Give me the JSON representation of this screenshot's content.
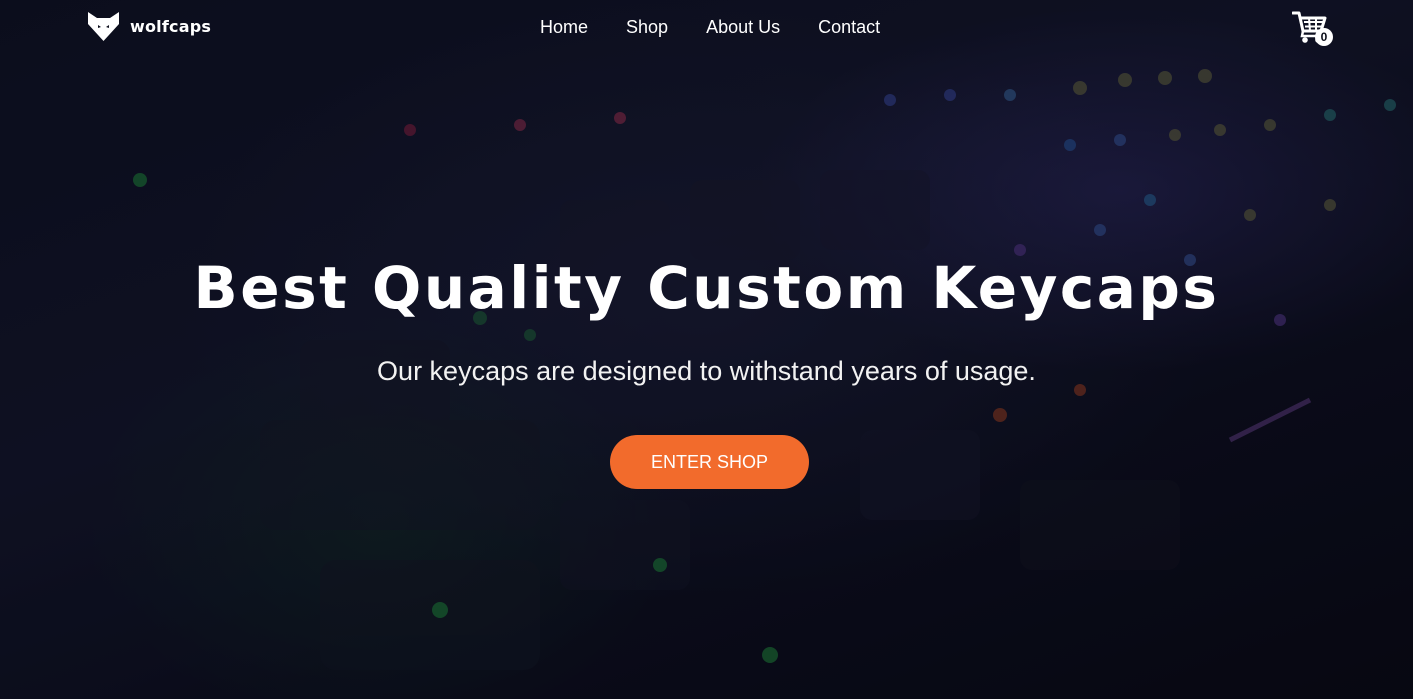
{
  "brand": {
    "name": "wolfcaps",
    "logo_icon": "wolf-head-icon"
  },
  "nav": {
    "items": [
      {
        "label": "Home"
      },
      {
        "label": "Shop"
      },
      {
        "label": "About Us"
      },
      {
        "label": "Contact"
      }
    ]
  },
  "cart": {
    "icon": "cart-icon",
    "count": "0"
  },
  "hero": {
    "title": "Best Quality Custom Keycaps",
    "subtitle": "Our keycaps are designed to withstand years of usage.",
    "cta_label": "ENTER SHOP",
    "background": "keyboard-photo"
  },
  "colors": {
    "accent": "#f26b2c",
    "background": "#0a0c18",
    "text": "#ffffff"
  }
}
